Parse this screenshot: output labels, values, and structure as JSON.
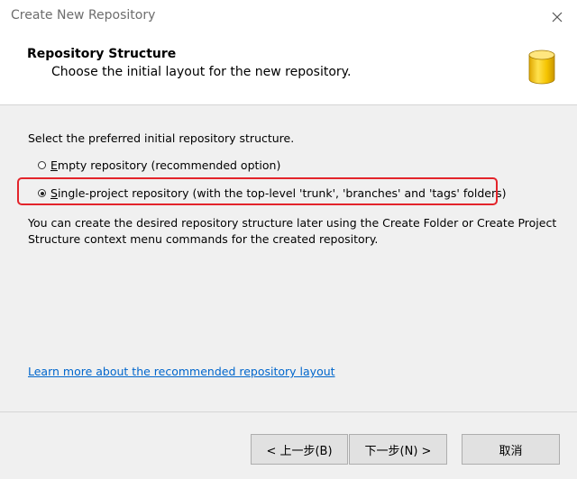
{
  "window": {
    "title": "Create New Repository",
    "close_icon": "close-icon"
  },
  "header": {
    "title": "Repository Structure",
    "subtitle": "Choose the initial layout for the new repository.",
    "icon": "database-icon",
    "icon_color": "#f5c400"
  },
  "content": {
    "prompt": "Select the preferred initial repository structure.",
    "options": [
      {
        "label_accel": "E",
        "label_rest": "mpty repository (recommended option)",
        "selected": false
      },
      {
        "label_accel": "S",
        "label_rest": "ingle-project repository (with the top-level 'trunk', 'branches' and 'tags' folders)",
        "selected": true
      }
    ],
    "info": "You can create the desired repository structure later using the Create Folder or Create Project Structure context menu commands for the created repository.",
    "learn_more_link": "Learn more about the recommended repository layout",
    "highlight_color": "#e3242b",
    "link_color": "#0066cc"
  },
  "footer": {
    "back_button": "< 上一步(B)",
    "next_button": "下一步(N) >",
    "cancel_button": "取消"
  }
}
